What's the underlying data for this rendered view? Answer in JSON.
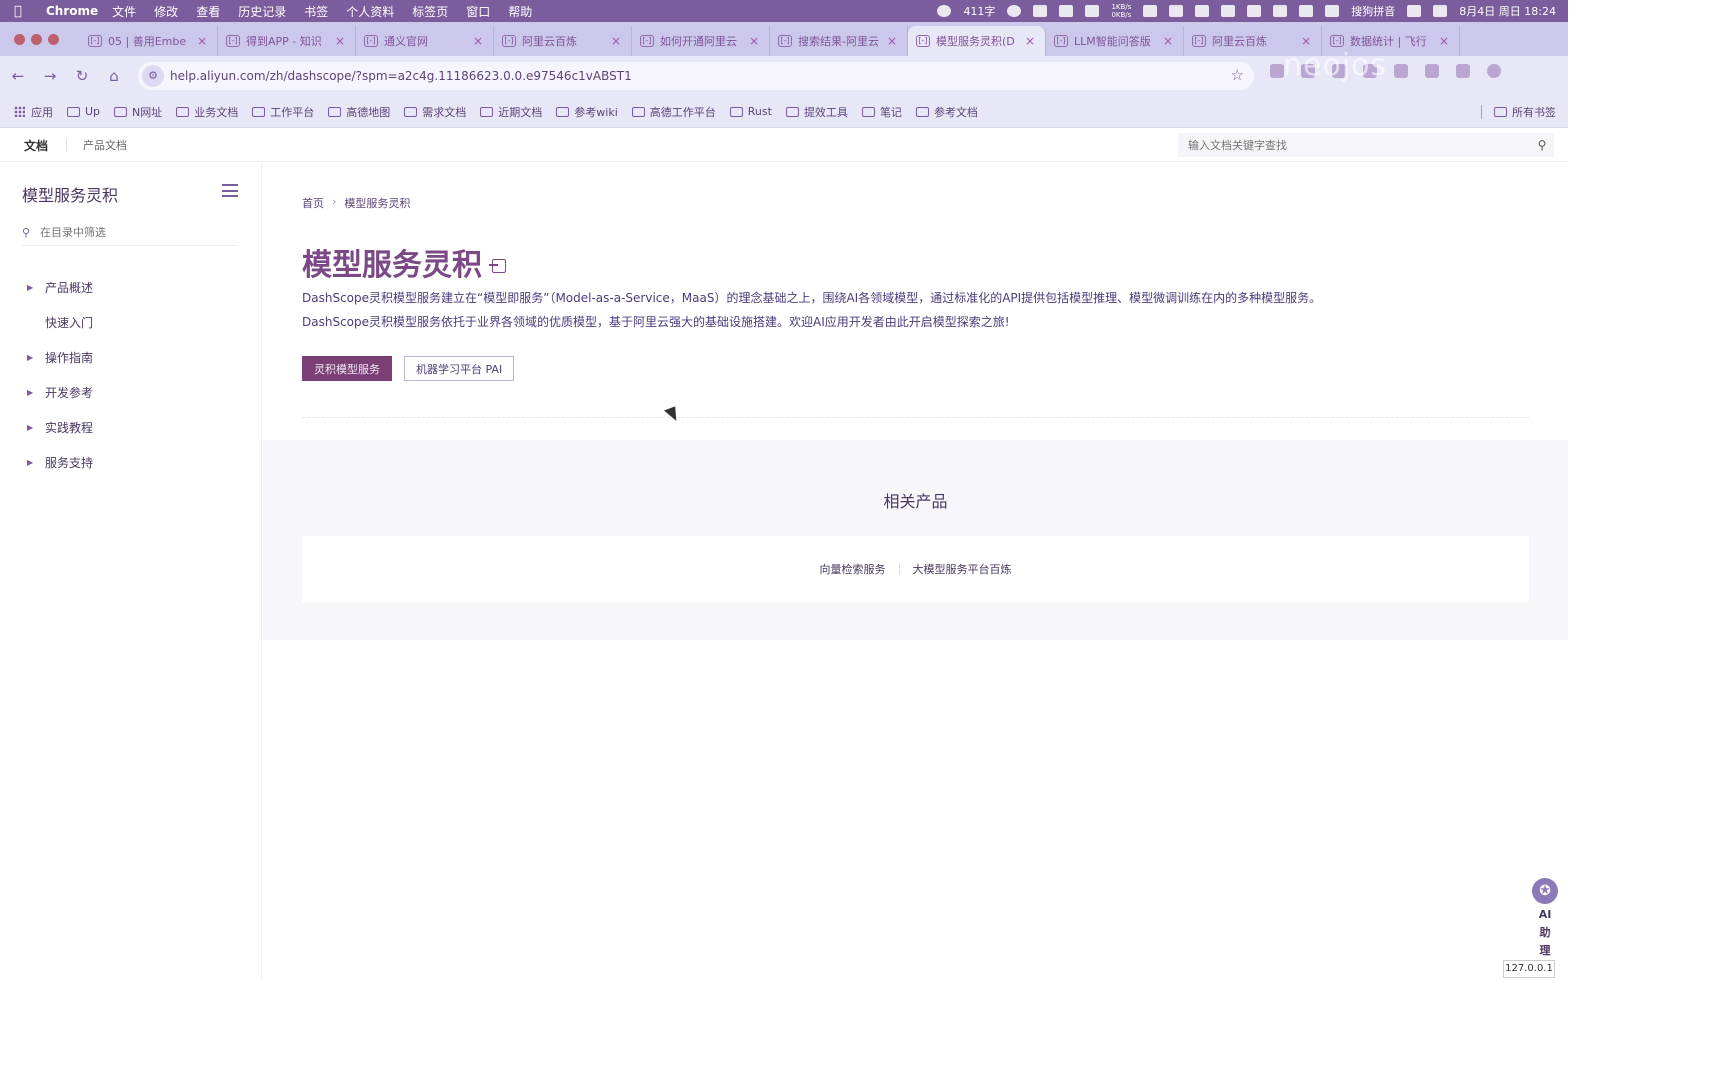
{
  "menubar": {
    "app_name": "Chrome",
    "items": [
      "文件",
      "修改",
      "查看",
      "历史记录",
      "书签",
      "个人资料",
      "标签页",
      "窗口",
      "帮助"
    ],
    "word_count": "411字",
    "net_up": "1KB/s",
    "net_down": "0KB/s",
    "ime": "搜狗拼音",
    "datetime": "8月4日 周日  18:24"
  },
  "tabs": [
    {
      "title": "05 | 善用Embe",
      "icon": "page-icon"
    },
    {
      "title": "得到APP - 知识",
      "icon": "page-icon"
    },
    {
      "title": "通义官网",
      "icon": "gear-icon"
    },
    {
      "title": "阿里云百炼",
      "icon": "aliyun-icon"
    },
    {
      "title": "如何开通阿里云",
      "icon": "aliyun-icon"
    },
    {
      "title": "搜索结果-阿里云",
      "icon": "aliyun-icon"
    },
    {
      "title": "模型服务灵积(D",
      "icon": "aliyun-icon",
      "active": true
    },
    {
      "title": "LLM智能问答版",
      "icon": "aliyun-icon"
    },
    {
      "title": "阿里云百炼",
      "icon": "aliyun-icon"
    },
    {
      "title": "数据统计 | 飞行",
      "icon": "page-icon"
    }
  ],
  "address": {
    "url": "help.aliyun.com/zh/dashscope/?spm=a2c4g.11186623.0.0.e97546c1vABST1"
  },
  "bookmarks": {
    "apps_label": "应用",
    "items": [
      "Up",
      "N网址",
      "业务文档",
      "工作平台",
      "高德地图",
      "需求文档",
      "近期文档",
      "参考wiki",
      "高德工作平台",
      "Rust",
      "提效工具",
      "笔记",
      "参考文档"
    ],
    "all_bookmarks": "所有书签"
  },
  "docs_header": {
    "docs": "文档",
    "product_docs": "产品文档",
    "search_placeholder": "输入文档关键字查找"
  },
  "sidebar": {
    "title": "模型服务灵积",
    "filter_placeholder": "在目录中筛选",
    "items": [
      {
        "label": "产品概述",
        "expandable": true
      },
      {
        "label": "快速入门",
        "expandable": false
      },
      {
        "label": "操作指南",
        "expandable": true
      },
      {
        "label": "开发参考",
        "expandable": true
      },
      {
        "label": "实践教程",
        "expandable": true
      },
      {
        "label": "服务支持",
        "expandable": true
      }
    ]
  },
  "main": {
    "breadcrumb": [
      "首页",
      "模型服务灵积"
    ],
    "title": "模型服务灵积",
    "intro": [
      "DashScope灵积模型服务建立在“模型即服务”（Model-as-a-Service，MaaS）的理念基础之上，围绕AI各领域模型，通过标准化的API提供包括模型推理、模型微调训练在内的多种模型服务。",
      "DashScope灵积模型服务依托于业界各领域的优质模型，基于阿里云强大的基础设施搭建。欢迎AI应用开发者由此开启模型探索之旅!"
    ],
    "primary_button": "灵积模型服务",
    "secondary_button": "机器学习平台 PAI",
    "related_title": "相关产品",
    "related_links": [
      "向量检索服务",
      "大模型服务平台百炼"
    ]
  },
  "ai_assistant": [
    "AI",
    "助",
    "理"
  ],
  "localhost_badge": "127.0.0.1",
  "watermark": "neojos"
}
